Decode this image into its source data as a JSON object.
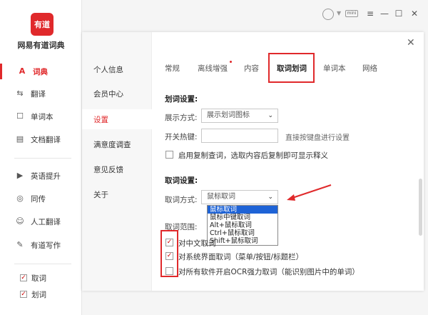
{
  "app": {
    "logo_text": "有道",
    "name": "网易有道词典"
  },
  "sidebar": {
    "items": [
      {
        "label": "词典",
        "icon": "dictionary-icon",
        "active": true
      },
      {
        "label": "翻译",
        "icon": "translate-icon"
      },
      {
        "label": "单词本",
        "icon": "wordbook-icon"
      },
      {
        "label": "文档翻译",
        "icon": "document-icon"
      },
      {
        "label": "英语提升",
        "icon": "english-boost-icon"
      },
      {
        "label": "同传",
        "icon": "interpretation-icon"
      },
      {
        "label": "人工翻译",
        "icon": "human-translate-icon"
      },
      {
        "label": "有道写作",
        "icon": "writing-icon"
      }
    ],
    "toggles": [
      {
        "label": "取词",
        "checked": true
      },
      {
        "label": "划词",
        "checked": true
      }
    ]
  },
  "titlebar": {
    "mini_label": "mini"
  },
  "dialog": {
    "side_items": [
      "个人信息",
      "会员中心",
      "设置",
      "满意度调查",
      "意见反馈",
      "关于"
    ],
    "active_side": "设置",
    "tabs": [
      "常规",
      "离线增强",
      "内容",
      "取词划词",
      "单词本",
      "网络"
    ],
    "active_tab": "取词划词",
    "huaci": {
      "section_title": "划词设置:",
      "display_label": "展示方式:",
      "display_value": "展示划词图标",
      "hotkey_label": "开关热键:",
      "hotkey_value": "",
      "hotkey_hint": "直接按键盘进行设置",
      "copy_query_label": "启用复制查词，选取内容后复制即可显示释义",
      "copy_query_checked": false
    },
    "quci": {
      "section_title": "取词设置:",
      "mode_label": "取词方式:",
      "mode_value": "鼠标取词",
      "mode_options": [
        "鼠标取词",
        "鼠标中键取词",
        "Alt+鼠标取词",
        "Ctrl+鼠标取词",
        "Shift+鼠标取词"
      ],
      "range_label": "取词范围:",
      "range_options": [
        {
          "label": "对中文取词",
          "checked": true
        },
        {
          "label": "对系统界面取词（菜单/按钮/标题栏）",
          "checked": true
        },
        {
          "label": "对所有软件开启OCR强力取词（能识别图片中的单词）",
          "checked": false
        }
      ]
    }
  },
  "colors": {
    "brand_red": "#e0292b",
    "select_blue": "#1e63d6"
  }
}
